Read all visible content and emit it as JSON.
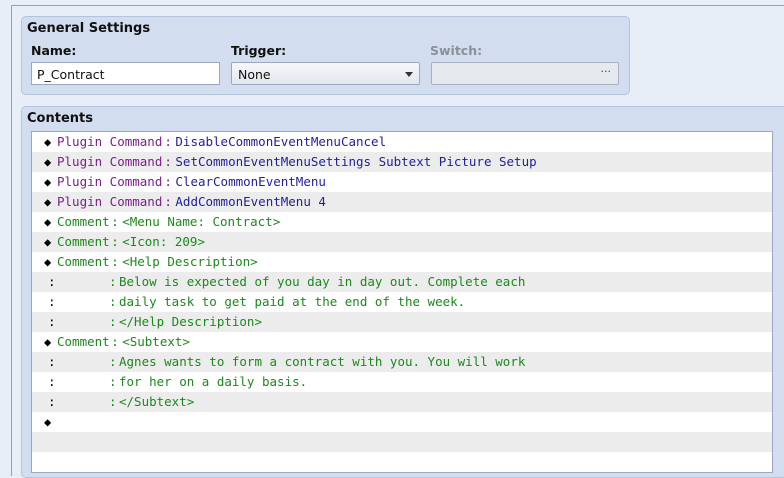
{
  "general": {
    "title": "General Settings",
    "name_label": "Name:",
    "name_value": "P_Contract",
    "trigger_label": "Trigger:",
    "trigger_value": "None",
    "switch_label": "Switch:",
    "switch_dots": "···"
  },
  "contents": {
    "title": "Contents",
    "rows": [
      {
        "kind": "command",
        "name": "Plugin Command",
        "sep": ":",
        "arg": "DisableCommonEventMenuCancel",
        "color": "plugin"
      },
      {
        "kind": "command",
        "name": "Plugin Command",
        "sep": ":",
        "arg": "SetCommonEventMenuSettings Subtext Picture Setup",
        "color": "plugin"
      },
      {
        "kind": "command",
        "name": "Plugin Command",
        "sep": ":",
        "arg": "ClearCommonEventMenu",
        "color": "plugin"
      },
      {
        "kind": "command",
        "name": "Plugin Command",
        "sep": ":",
        "arg": "AddCommonEventMenu 4",
        "color": "plugin"
      },
      {
        "kind": "command",
        "name": "Comment",
        "sep": ":",
        "arg": "<Menu Name: Contract>",
        "color": "comment"
      },
      {
        "kind": "command",
        "name": "Comment",
        "sep": ":",
        "arg": "<Icon: 209>",
        "color": "comment"
      },
      {
        "kind": "command",
        "name": "Comment",
        "sep": ":",
        "arg": "<Help Description>",
        "color": "comment"
      },
      {
        "kind": "cont",
        "lead": ":",
        "sep": ":",
        "arg": "Below is expected of you day in day out. Complete each",
        "color": "comment"
      },
      {
        "kind": "cont",
        "lead": ":",
        "sep": ":",
        "arg": "daily task to get paid at the end of the week.",
        "color": "comment"
      },
      {
        "kind": "cont",
        "lead": ":",
        "sep": ":",
        "arg": "</Help Description>",
        "color": "comment"
      },
      {
        "kind": "command",
        "name": "Comment",
        "sep": ":",
        "arg": "<Subtext>",
        "color": "comment"
      },
      {
        "kind": "cont",
        "lead": ":",
        "sep": ":",
        "arg": "Agnes wants to form a contract with you. You will work",
        "color": "comment"
      },
      {
        "kind": "cont",
        "lead": ":",
        "sep": ":",
        "arg": "for her on a daily basis.",
        "color": "comment"
      },
      {
        "kind": "cont",
        "lead": ":",
        "sep": ":",
        "arg": "</Subtext>",
        "color": "comment"
      },
      {
        "kind": "empty"
      },
      {
        "kind": "blank"
      },
      {
        "kind": "blank"
      }
    ]
  },
  "colors": {
    "plugin": "#7a1f8c",
    "plugin_arg": "#1f1f9a",
    "comment": "#1a8a1a"
  }
}
